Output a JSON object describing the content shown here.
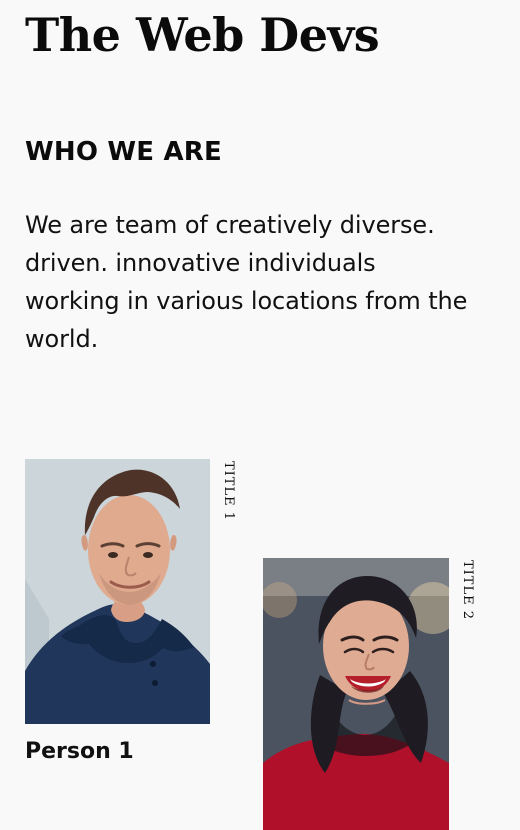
{
  "site": {
    "title": "The Web Devs"
  },
  "about": {
    "heading": "WHO WE ARE",
    "lines": [
      "We are team of creatively diverse.",
      "driven. innovative individuals",
      "working in various locations from the",
      "world."
    ]
  },
  "team": {
    "members": [
      {
        "title": "TITLE 1",
        "name": "Person 1"
      },
      {
        "title": "TITLE 2"
      }
    ]
  },
  "colors": {
    "background": "#f9f9f9",
    "text": "#111111"
  }
}
